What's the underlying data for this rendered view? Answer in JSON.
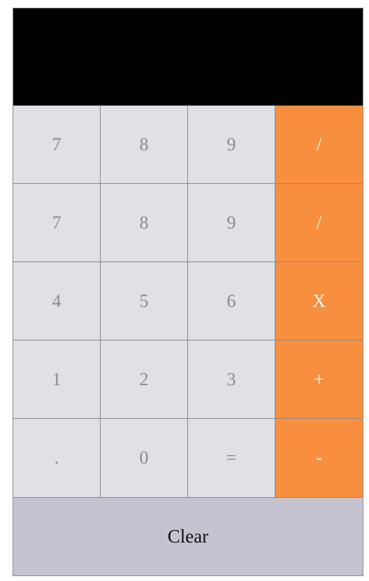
{
  "display": {
    "value": ""
  },
  "keypad": {
    "rows": [
      [
        {
          "label": "7",
          "kind": "num"
        },
        {
          "label": "8",
          "kind": "num"
        },
        {
          "label": "9",
          "kind": "num"
        },
        {
          "label": "/",
          "kind": "op"
        }
      ],
      [
        {
          "label": "7",
          "kind": "num"
        },
        {
          "label": "8",
          "kind": "num"
        },
        {
          "label": "9",
          "kind": "num"
        },
        {
          "label": "/",
          "kind": "op"
        }
      ],
      [
        {
          "label": "4",
          "kind": "num"
        },
        {
          "label": "5",
          "kind": "num"
        },
        {
          "label": "6",
          "kind": "num"
        },
        {
          "label": "X",
          "kind": "op"
        }
      ],
      [
        {
          "label": "1",
          "kind": "num"
        },
        {
          "label": "2",
          "kind": "num"
        },
        {
          "label": "3",
          "kind": "num"
        },
        {
          "label": "+",
          "kind": "op"
        }
      ],
      [
        {
          "label": ".",
          "kind": "num"
        },
        {
          "label": "0",
          "kind": "num"
        },
        {
          "label": "=",
          "kind": "num"
        },
        {
          "label": "-",
          "kind": "op"
        }
      ]
    ]
  },
  "clear_label": "Clear",
  "colors": {
    "display_bg": "#000000",
    "number_key_bg": "#e0e0e6",
    "number_key_text": "#8b8b8b",
    "operator_key_bg": "#f88f3e",
    "operator_key_text": "#ffffff",
    "clear_bg": "#c5c3cf"
  }
}
